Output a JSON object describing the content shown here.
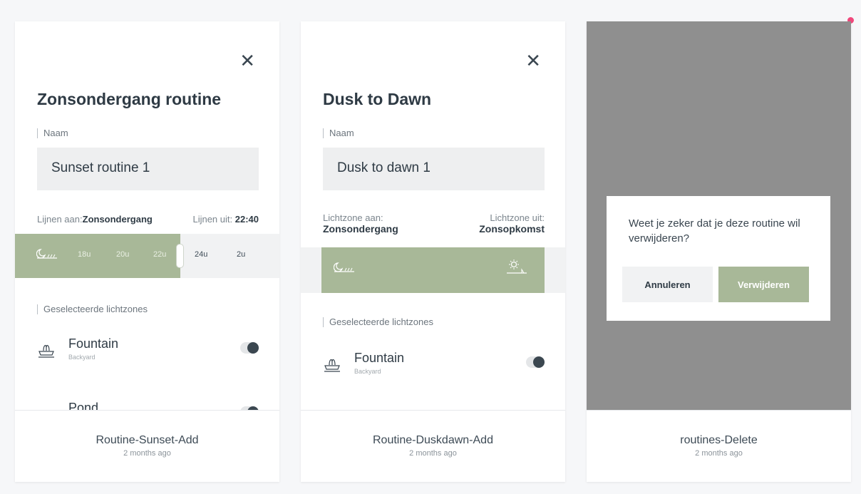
{
  "accent_color": "#a8b898",
  "notification_dot_color": "#f0487c",
  "cards": [
    {
      "title": "Zonsondergang routine",
      "name_label": "Naam",
      "name_value": "Sunset routine 1",
      "lines_on_label": "Lijnen aan:",
      "lines_on_value": "Zonsondergang",
      "lines_off_label": "Lijnen uit:",
      "lines_off_value": "22:40",
      "timeline_ticks": [
        "18u",
        "20u",
        "22u",
        "24u",
        "2u"
      ],
      "selected_zones_label": "Geselecteerde lichtzones",
      "zones": [
        {
          "name": "Fountain",
          "sub": "Backyard"
        },
        {
          "name": "Pond",
          "sub": ""
        }
      ],
      "footer_name": "Routine-Sunset-Add",
      "footer_time": "2 months ago"
    },
    {
      "title": "Dusk to Dawn",
      "name_label": "Naam",
      "name_value": "Dusk to dawn 1",
      "zone_on_label": "Lichtzone aan:",
      "zone_on_value": "Zonsondergang",
      "zone_off_label": "Lichtzone uit:",
      "zone_off_value": "Zonsopkomst",
      "selected_zones_label": "Geselecteerde lichtzones",
      "zones": [
        {
          "name": "Fountain",
          "sub": "Backyard"
        }
      ],
      "footer_name": "Routine-Duskdawn-Add",
      "footer_time": "2 months ago"
    },
    {
      "dialog_question": "Weet je zeker dat je deze routine wil verwijderen?",
      "cancel_label": "Annuleren",
      "delete_label": "Verwijderen",
      "footer_name": "routines-Delete",
      "footer_time": "2 months ago"
    }
  ]
}
